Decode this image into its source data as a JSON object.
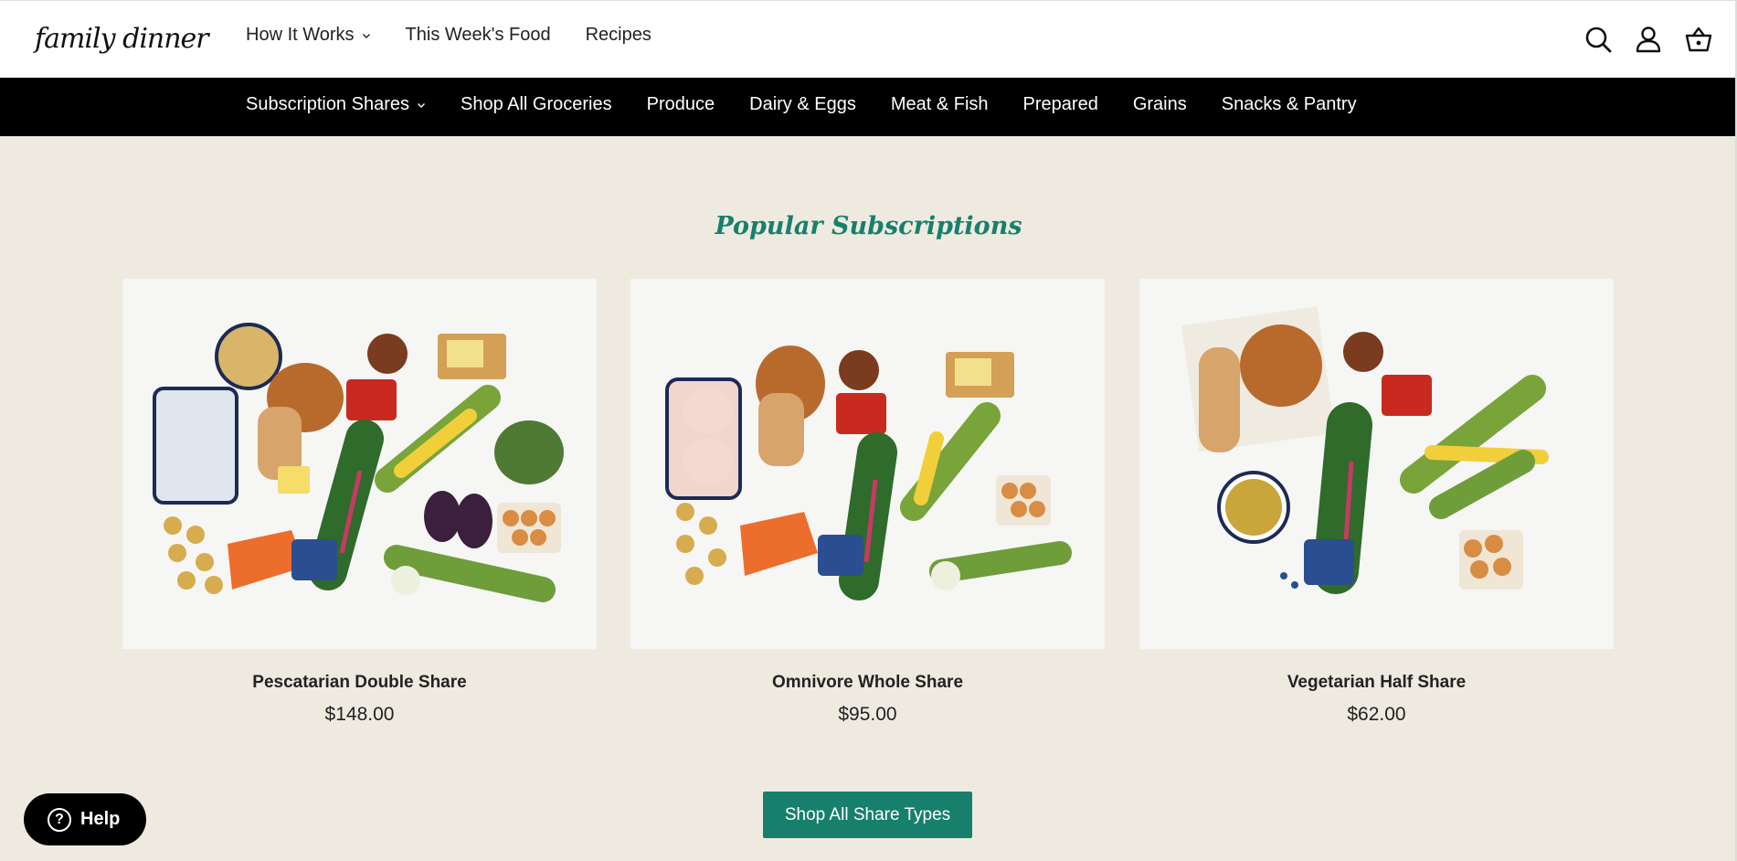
{
  "brand": {
    "logo_text": "family dinner"
  },
  "top_nav": [
    {
      "label": "How It Works",
      "has_dropdown": true
    },
    {
      "label": "This Week's Food",
      "has_dropdown": false
    },
    {
      "label": "Recipes",
      "has_dropdown": false
    }
  ],
  "header_icons": [
    "search-icon",
    "account-icon",
    "basket-icon"
  ],
  "category_nav": [
    {
      "label": "Subscription Shares",
      "has_dropdown": true
    },
    {
      "label": "Shop All Groceries"
    },
    {
      "label": "Produce"
    },
    {
      "label": "Dairy & Eggs"
    },
    {
      "label": "Meat & Fish"
    },
    {
      "label": "Prepared"
    },
    {
      "label": "Grains"
    },
    {
      "label": "Snacks & Pantry"
    }
  ],
  "section": {
    "title": "Popular Subscriptions"
  },
  "products": [
    {
      "name": "Pescatarian Double Share",
      "price": "$148.00"
    },
    {
      "name": "Omnivore Whole Share",
      "price": "$95.00"
    },
    {
      "name": "Vegetarian Half Share",
      "price": "$62.00"
    }
  ],
  "cta": {
    "label": "Shop All Share Types"
  },
  "help": {
    "label": "Help"
  },
  "colors": {
    "accent": "#17806d",
    "background": "#efeae0",
    "catbar": "#000000"
  }
}
